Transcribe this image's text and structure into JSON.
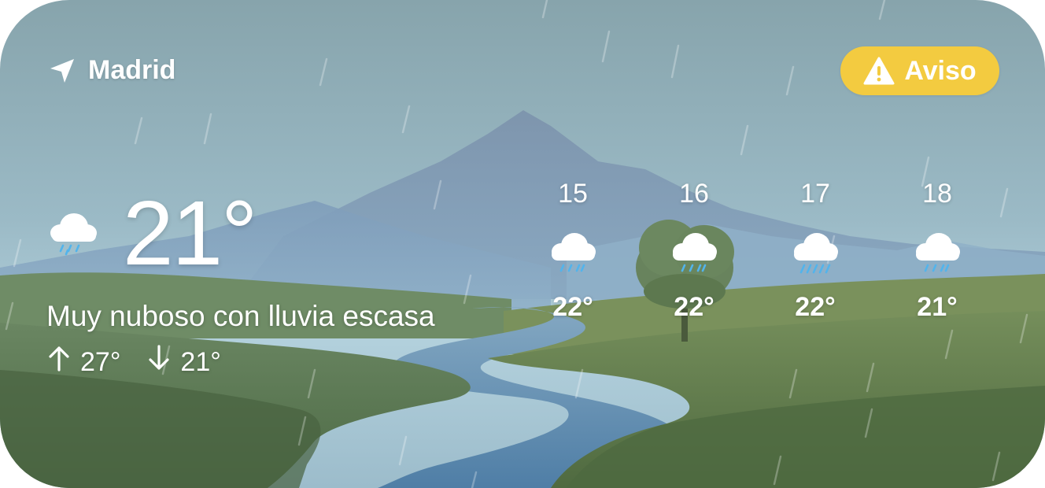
{
  "location": {
    "icon": "location-arrow-icon",
    "name": "Madrid"
  },
  "alert": {
    "icon": "warning-triangle-icon",
    "label": "Aviso",
    "color": "#f3cb40"
  },
  "current": {
    "icon": "cloud-rain-icon",
    "temperature": "21°",
    "condition": "Muy nuboso con lluvia escasa",
    "high_icon": "arrow-up-icon",
    "high": "27°",
    "low_icon": "arrow-down-icon",
    "low": "21°"
  },
  "forecast": [
    {
      "hour": "15",
      "icon": "cloud-rain-icon",
      "temp": "22°"
    },
    {
      "hour": "16",
      "icon": "cloud-rain-icon",
      "temp": "22°"
    },
    {
      "hour": "17",
      "icon": "cloud-rain-heavy-icon",
      "temp": "22°"
    },
    {
      "hour": "18",
      "icon": "cloud-rain-icon",
      "temp": "21°"
    }
  ],
  "colors": {
    "sky_top": "#86a5ad",
    "sky_bottom": "#b3d2de",
    "mountain": "#7f98b3",
    "hills": "#5f7a52",
    "river": "#5f8caf",
    "rain_drop": "#52b4ec"
  }
}
